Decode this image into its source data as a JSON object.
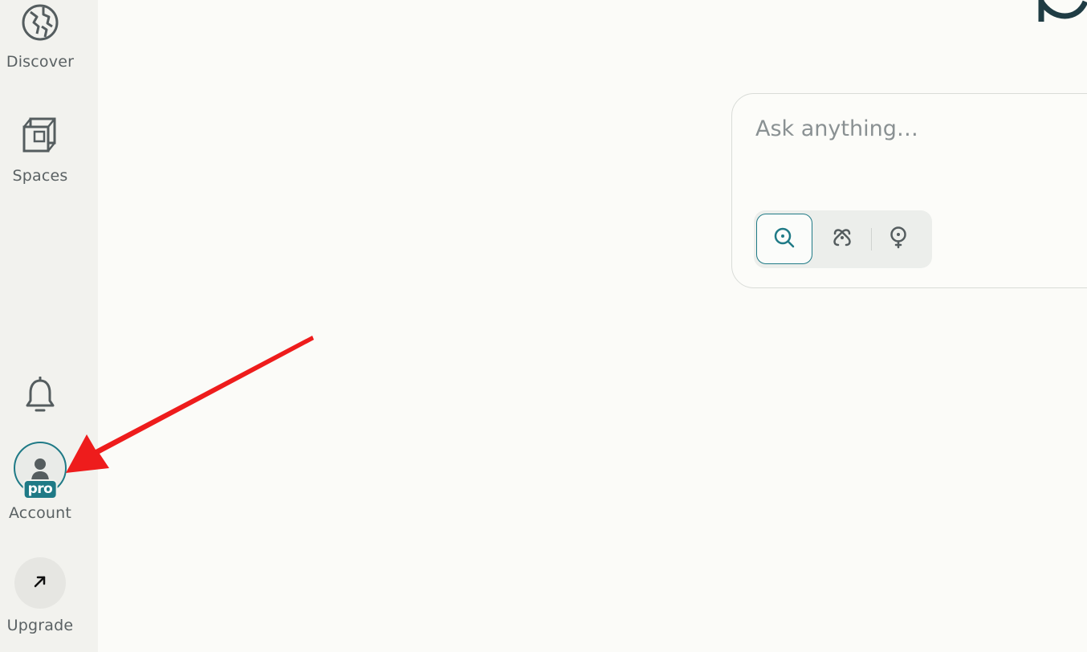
{
  "sidebar": {
    "discover": {
      "label": "Discover",
      "icon": "globe-icon"
    },
    "spaces": {
      "label": "Spaces",
      "icon": "spaces-icon"
    },
    "notifications": {
      "icon": "bell-icon"
    },
    "account": {
      "label": "Account",
      "badge": "pro",
      "icon": "person-icon"
    },
    "upgrade": {
      "label": "Upgrade",
      "icon": "arrow-up-right-icon"
    }
  },
  "search": {
    "placeholder": "Ask anything…",
    "value": "",
    "modes": [
      {
        "name": "Search",
        "icon": "search-icon",
        "selected": true
      },
      {
        "name": "Research",
        "icon": "research-icon",
        "selected": false
      },
      {
        "name": "Reason",
        "icon": "lightbulb-icon",
        "selected": false
      }
    ]
  },
  "annotation": {
    "type": "arrow",
    "color": "#ee1c1c",
    "points_to": "Account"
  },
  "colors": {
    "accent": "#1f7a86",
    "sidebar_bg": "#f2f2ee",
    "page_bg": "#fbfbf8",
    "annotation": "#ee1c1c"
  }
}
